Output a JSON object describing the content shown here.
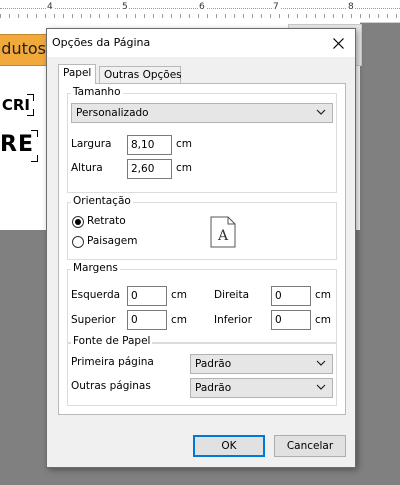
{
  "background": {
    "ruler_numbers": [
      "4",
      "5",
      "6",
      "7",
      "8"
    ],
    "banner_text": "dutos",
    "label_1": "CRI",
    "label_2": "REC"
  },
  "dialog": {
    "title": "Opções da Página",
    "close_icon": "close-icon",
    "tabs": [
      {
        "label": "Papel",
        "active": true
      },
      {
        "label": "Outras Opções",
        "active": false
      }
    ],
    "tamanho": {
      "legend": "Tamanho",
      "size_select": "Personalizado",
      "largura_label": "Largura",
      "largura_value": "8,10",
      "altura_label": "Altura",
      "altura_value": "2,60",
      "unit": "cm"
    },
    "orientacao": {
      "legend": "Orientação",
      "options": [
        {
          "label": "Retrato",
          "checked": true
        },
        {
          "label": "Paisagem",
          "checked": false
        }
      ],
      "preview_letter": "A"
    },
    "margens": {
      "legend": "Margens",
      "esquerda_label": "Esquerda",
      "esquerda_value": "0",
      "direita_label": "Direita",
      "direita_value": "0",
      "superior_label": "Superior",
      "superior_value": "0",
      "inferior_label": "Inferior",
      "inferior_value": "0",
      "unit": "cm"
    },
    "fonte_papel": {
      "legend": "Fonte de Papel",
      "primeira_label": "Primeira página",
      "primeira_value": "Padrão",
      "outras_label": "Outras páginas",
      "outras_value": "Padrão"
    },
    "ok_label": "OK",
    "cancel_label": "Cancelar"
  },
  "colors": {
    "banner": "#f0a93a",
    "focus_border": "#0078d7"
  }
}
